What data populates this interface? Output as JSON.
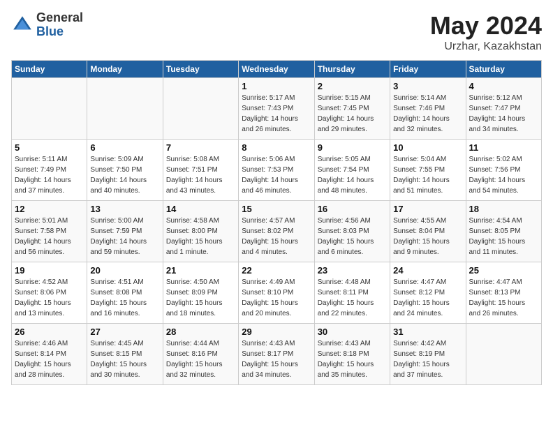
{
  "header": {
    "logo_general": "General",
    "logo_blue": "Blue",
    "month_year": "May 2024",
    "location": "Urzhar, Kazakhstan"
  },
  "weekdays": [
    "Sunday",
    "Monday",
    "Tuesday",
    "Wednesday",
    "Thursday",
    "Friday",
    "Saturday"
  ],
  "weeks": [
    [
      {
        "day": "",
        "info": ""
      },
      {
        "day": "",
        "info": ""
      },
      {
        "day": "",
        "info": ""
      },
      {
        "day": "1",
        "info": "Sunrise: 5:17 AM\nSunset: 7:43 PM\nDaylight: 14 hours\nand 26 minutes."
      },
      {
        "day": "2",
        "info": "Sunrise: 5:15 AM\nSunset: 7:45 PM\nDaylight: 14 hours\nand 29 minutes."
      },
      {
        "day": "3",
        "info": "Sunrise: 5:14 AM\nSunset: 7:46 PM\nDaylight: 14 hours\nand 32 minutes."
      },
      {
        "day": "4",
        "info": "Sunrise: 5:12 AM\nSunset: 7:47 PM\nDaylight: 14 hours\nand 34 minutes."
      }
    ],
    [
      {
        "day": "5",
        "info": "Sunrise: 5:11 AM\nSunset: 7:49 PM\nDaylight: 14 hours\nand 37 minutes."
      },
      {
        "day": "6",
        "info": "Sunrise: 5:09 AM\nSunset: 7:50 PM\nDaylight: 14 hours\nand 40 minutes."
      },
      {
        "day": "7",
        "info": "Sunrise: 5:08 AM\nSunset: 7:51 PM\nDaylight: 14 hours\nand 43 minutes."
      },
      {
        "day": "8",
        "info": "Sunrise: 5:06 AM\nSunset: 7:53 PM\nDaylight: 14 hours\nand 46 minutes."
      },
      {
        "day": "9",
        "info": "Sunrise: 5:05 AM\nSunset: 7:54 PM\nDaylight: 14 hours\nand 48 minutes."
      },
      {
        "day": "10",
        "info": "Sunrise: 5:04 AM\nSunset: 7:55 PM\nDaylight: 14 hours\nand 51 minutes."
      },
      {
        "day": "11",
        "info": "Sunrise: 5:02 AM\nSunset: 7:56 PM\nDaylight: 14 hours\nand 54 minutes."
      }
    ],
    [
      {
        "day": "12",
        "info": "Sunrise: 5:01 AM\nSunset: 7:58 PM\nDaylight: 14 hours\nand 56 minutes."
      },
      {
        "day": "13",
        "info": "Sunrise: 5:00 AM\nSunset: 7:59 PM\nDaylight: 14 hours\nand 59 minutes."
      },
      {
        "day": "14",
        "info": "Sunrise: 4:58 AM\nSunset: 8:00 PM\nDaylight: 15 hours\nand 1 minute."
      },
      {
        "day": "15",
        "info": "Sunrise: 4:57 AM\nSunset: 8:02 PM\nDaylight: 15 hours\nand 4 minutes."
      },
      {
        "day": "16",
        "info": "Sunrise: 4:56 AM\nSunset: 8:03 PM\nDaylight: 15 hours\nand 6 minutes."
      },
      {
        "day": "17",
        "info": "Sunrise: 4:55 AM\nSunset: 8:04 PM\nDaylight: 15 hours\nand 9 minutes."
      },
      {
        "day": "18",
        "info": "Sunrise: 4:54 AM\nSunset: 8:05 PM\nDaylight: 15 hours\nand 11 minutes."
      }
    ],
    [
      {
        "day": "19",
        "info": "Sunrise: 4:52 AM\nSunset: 8:06 PM\nDaylight: 15 hours\nand 13 minutes."
      },
      {
        "day": "20",
        "info": "Sunrise: 4:51 AM\nSunset: 8:08 PM\nDaylight: 15 hours\nand 16 minutes."
      },
      {
        "day": "21",
        "info": "Sunrise: 4:50 AM\nSunset: 8:09 PM\nDaylight: 15 hours\nand 18 minutes."
      },
      {
        "day": "22",
        "info": "Sunrise: 4:49 AM\nSunset: 8:10 PM\nDaylight: 15 hours\nand 20 minutes."
      },
      {
        "day": "23",
        "info": "Sunrise: 4:48 AM\nSunset: 8:11 PM\nDaylight: 15 hours\nand 22 minutes."
      },
      {
        "day": "24",
        "info": "Sunrise: 4:47 AM\nSunset: 8:12 PM\nDaylight: 15 hours\nand 24 minutes."
      },
      {
        "day": "25",
        "info": "Sunrise: 4:47 AM\nSunset: 8:13 PM\nDaylight: 15 hours\nand 26 minutes."
      }
    ],
    [
      {
        "day": "26",
        "info": "Sunrise: 4:46 AM\nSunset: 8:14 PM\nDaylight: 15 hours\nand 28 minutes."
      },
      {
        "day": "27",
        "info": "Sunrise: 4:45 AM\nSunset: 8:15 PM\nDaylight: 15 hours\nand 30 minutes."
      },
      {
        "day": "28",
        "info": "Sunrise: 4:44 AM\nSunset: 8:16 PM\nDaylight: 15 hours\nand 32 minutes."
      },
      {
        "day": "29",
        "info": "Sunrise: 4:43 AM\nSunset: 8:17 PM\nDaylight: 15 hours\nand 34 minutes."
      },
      {
        "day": "30",
        "info": "Sunrise: 4:43 AM\nSunset: 8:18 PM\nDaylight: 15 hours\nand 35 minutes."
      },
      {
        "day": "31",
        "info": "Sunrise: 4:42 AM\nSunset: 8:19 PM\nDaylight: 15 hours\nand 37 minutes."
      },
      {
        "day": "",
        "info": ""
      }
    ]
  ]
}
